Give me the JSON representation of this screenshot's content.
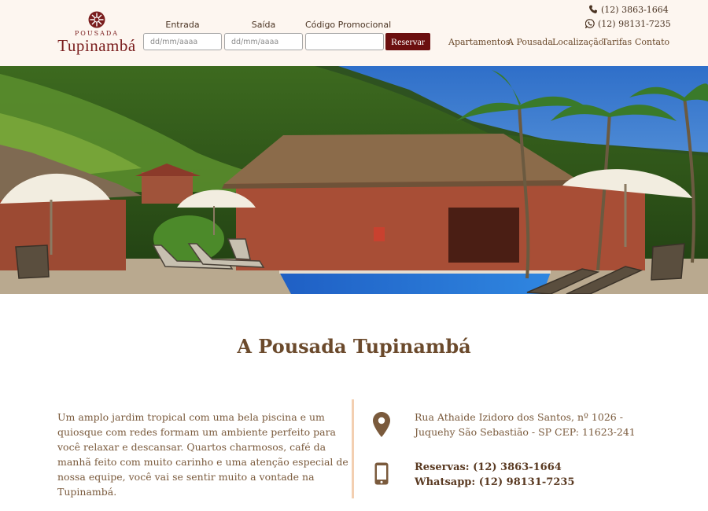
{
  "brand": {
    "small_text": "POUSADA",
    "name": "Tupinambá"
  },
  "booking": {
    "checkin_label": "Entrada",
    "checkin_placeholder": "dd/mm/aaaa",
    "checkout_label": "Saída",
    "checkout_placeholder": "dd/mm/aaaa",
    "promo_label": "Código Promocional",
    "promo_value": "",
    "submit_label": "Reservar"
  },
  "header_contacts": {
    "phone": "(12) 3863-1664",
    "phone_icon": "phone-icon",
    "whatsapp": "(12) 98131-7235",
    "whatsapp_icon": "whatsapp-icon"
  },
  "nav": {
    "items": [
      "Apartamentos",
      "A Pousada",
      "Localização",
      "Tarifas",
      "Contato"
    ]
  },
  "hero": {
    "image": "pousada-pool-garden-photo"
  },
  "section": {
    "title": "A Pousada Tupinambá",
    "intro": "Um amplo jardim tropical com uma bela piscina e um quiosque com redes formam um ambiente perfeito para você relaxar e descansar. Quartos charmosos, café da manhã feito com muito carinho e uma atenção especial de nossa equipe, você vai se sentir muito a vontade na Tupinambá."
  },
  "info": {
    "address_line1": "Rua Athaide Izidoro dos Santos, nº 1026 -",
    "address_line2": "Juquehy São Sebastião - SP CEP: 11623-241",
    "address_icon": "map-pin-icon",
    "reservas": "Reservas: (12) 3863-1664",
    "whatsapp": "Whatsapp: (12) 98131-7235",
    "phone_icon": "mobile-phone-icon"
  },
  "colors": {
    "header_bg": "#fdf6f0",
    "brand": "#7a1d1d",
    "button": "#6b0f0f",
    "text_brown": "#6b4a2c",
    "divider": "#f3cfb1"
  }
}
